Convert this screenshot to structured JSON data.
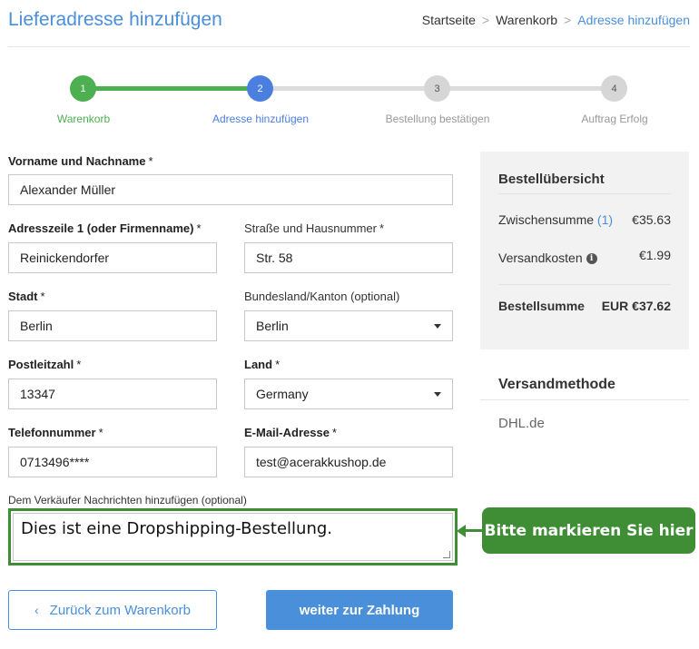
{
  "header": {
    "title": "Lieferadresse hinzufügen",
    "breadcrumb": [
      "Startseite",
      "Warenkorb",
      "Adresse hinzufügen"
    ],
    "separator": ">"
  },
  "steps": [
    {
      "number": "1",
      "label": "Warenkorb",
      "state": "done",
      "color": "#4caf50"
    },
    {
      "number": "2",
      "label": "Adresse hinzufügen",
      "state": "current",
      "color": "#4a7fe0"
    },
    {
      "number": "3",
      "label": "Bestellung bestätigen",
      "state": "pending",
      "color": "#d6d6d6"
    },
    {
      "number": "4",
      "label": "Auftrag Erfolg",
      "state": "pending",
      "color": "#d6d6d6"
    }
  ],
  "form": {
    "name": {
      "label": "Vorname und Nachname",
      "required": "*",
      "value": "Alexander Müller"
    },
    "address1": {
      "label": "Adresszeile 1 (oder Firmenname)",
      "required": "*",
      "value": "Reinickendorfer"
    },
    "street": {
      "label": "Straße und Hausnummer",
      "required": "*",
      "value": "Str. 58"
    },
    "city": {
      "label": "Stadt",
      "required": "*",
      "value": "Berlin"
    },
    "state": {
      "label": "Bundesland/Kanton (optional)",
      "value": "Berlin"
    },
    "zip": {
      "label": "Postleitzahl",
      "required": "*",
      "value": "13347"
    },
    "country": {
      "label": "Land",
      "required": "*",
      "value": "Germany"
    },
    "phone": {
      "label": "Telefonnummer",
      "required": "*",
      "value": "0713496****"
    },
    "email": {
      "label": "E-Mail-Adresse",
      "required": "*",
      "value": "test@acerakkushop.de"
    },
    "message": {
      "label": "Dem Verkäufer Nachrichten hinzufügen (optional)",
      "value": "Dies ist eine Dropshipping-Bestellung."
    }
  },
  "callout": {
    "text": "Bitte markieren Sie hier",
    "color": "#3f8e36"
  },
  "buttons": {
    "back": {
      "label": "Zurück zum Warenkorb",
      "chevron": "‹"
    },
    "next": {
      "label": "weiter zur Zahlung"
    }
  },
  "summary": {
    "title": "Bestellübersicht",
    "subtotal_label": "Zwischensumme",
    "subtotal_count": "(1)",
    "subtotal_value": "€35.63",
    "shipping_label": "Versandkosten",
    "shipping_value": "€1.99",
    "total_label": "Bestellsumme",
    "total_value": "EUR €37.62"
  },
  "shipping_method": {
    "title": "Versandmethode",
    "value": "DHL.de"
  },
  "colors": {
    "accent": "#4a8fd9",
    "success": "#4caf50",
    "highlight": "#3f8e36"
  }
}
